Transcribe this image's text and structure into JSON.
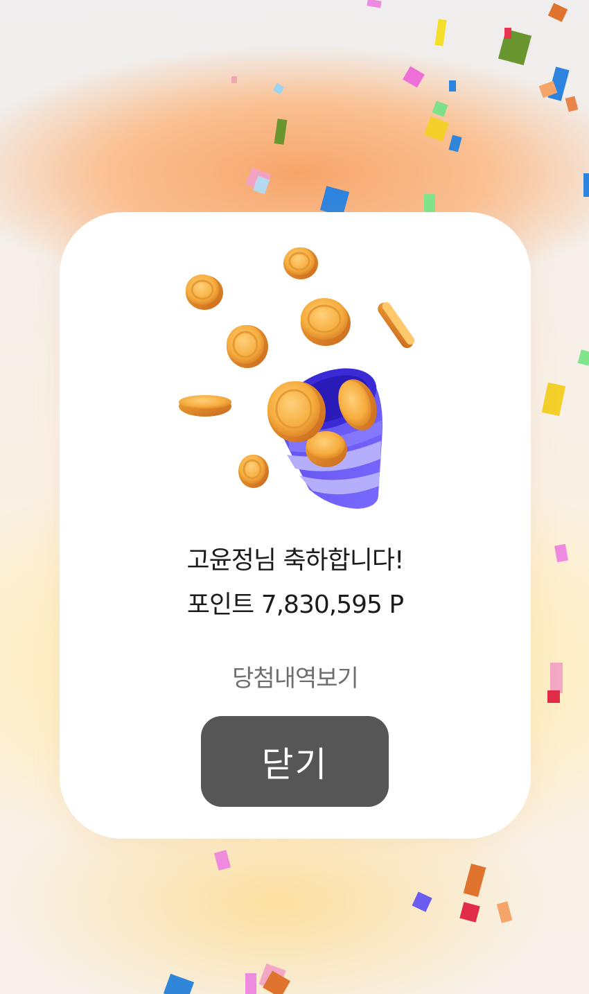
{
  "modal": {
    "congrats_text": "고윤정님 축하합니다!",
    "points_text": "포인트 7,830,595 P",
    "history_link_label": "당첨내역보기",
    "close_button_label": "닫기"
  },
  "illustration": {
    "icon": "party-popper-with-coins-icon",
    "popper_color": "#6a5cf0",
    "coin_color": "#f2a93b"
  },
  "colors": {
    "close_button_bg": "#575656",
    "card_bg": "#ffffff",
    "background_accent": "#f7a56a"
  }
}
